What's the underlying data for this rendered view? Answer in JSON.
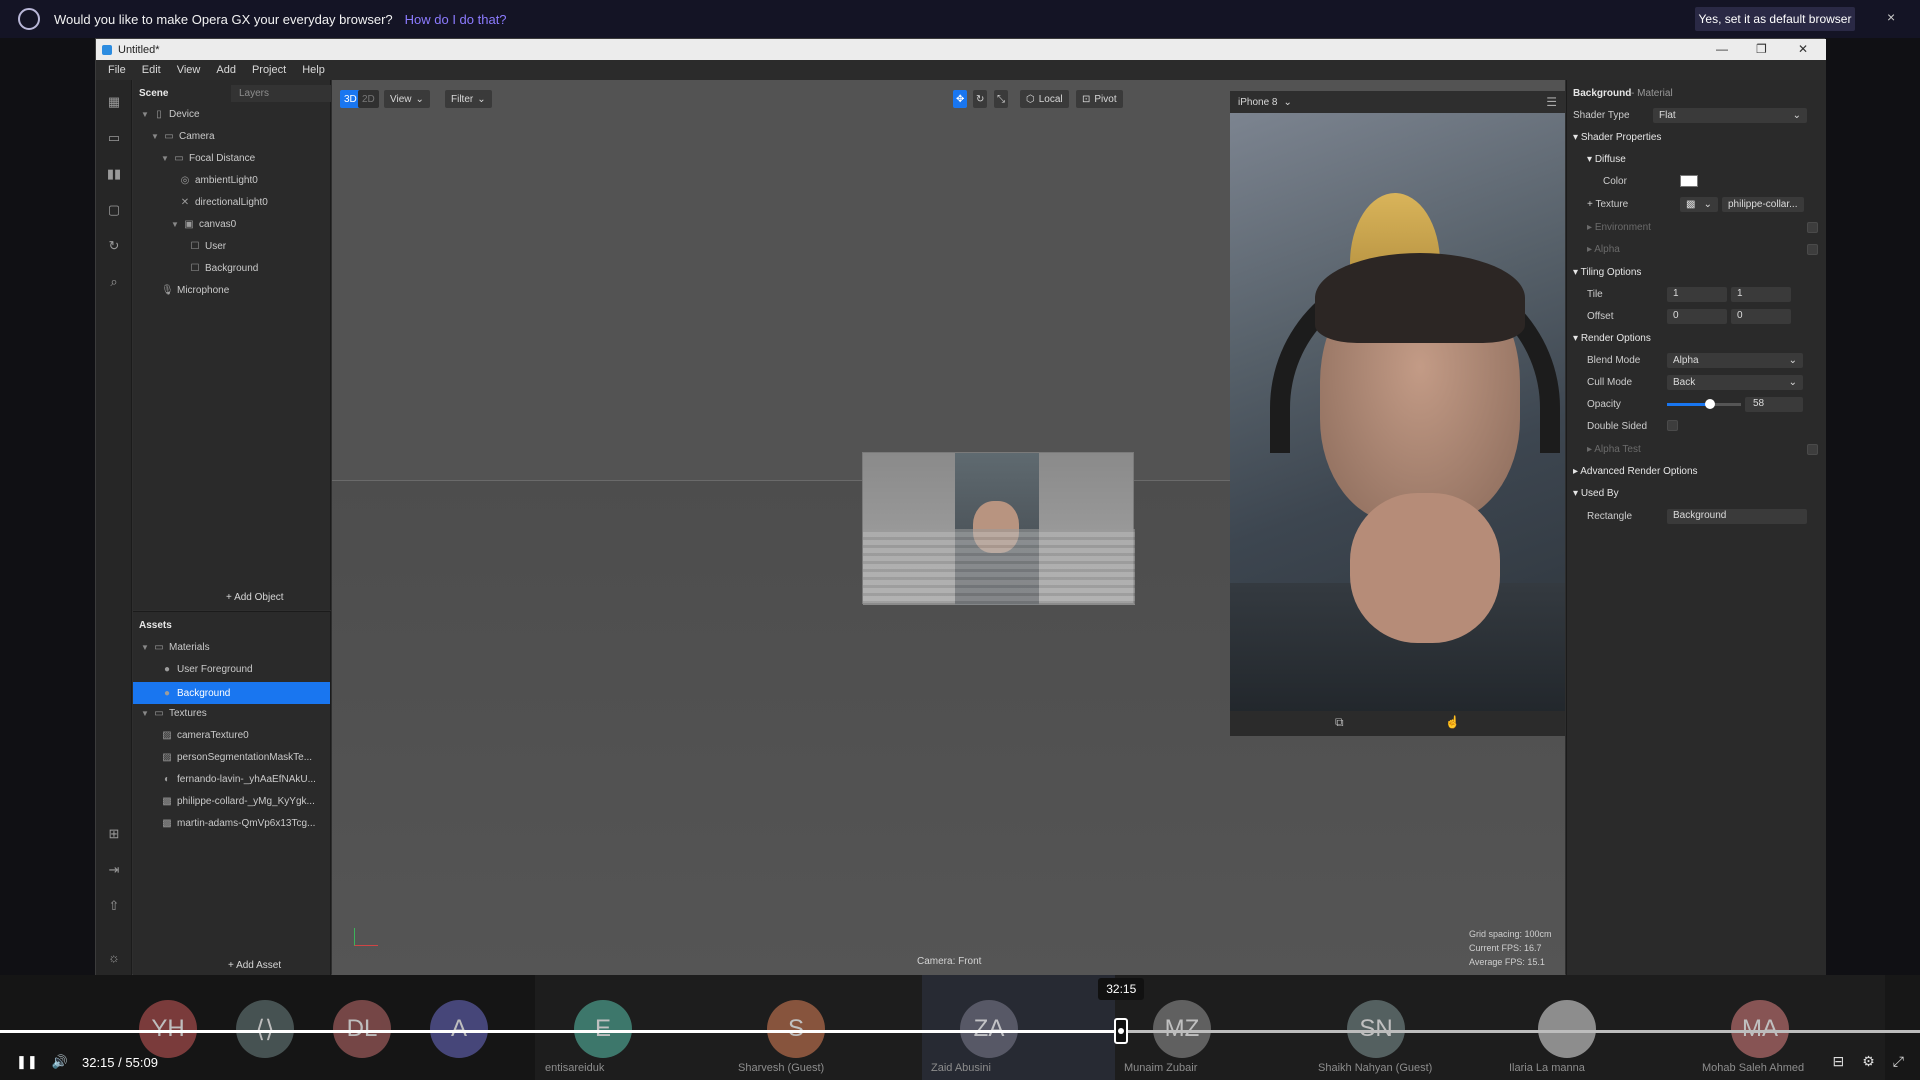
{
  "opera": {
    "question": "Would you like to make Opera GX your everyday browser?",
    "how": "How do I do that?",
    "yes": "Yes, set it as default browser",
    "close": "×"
  },
  "window": {
    "title": "Untitled*",
    "minimize": "—",
    "restore": "❐",
    "close": "✕"
  },
  "menu": [
    "File",
    "Edit",
    "View",
    "Add",
    "Project",
    "Help"
  ],
  "scene": {
    "title": "Scene",
    "tab": "Layers",
    "items": [
      {
        "label": "Device"
      },
      {
        "label": "Camera"
      },
      {
        "label": "Focal Distance"
      },
      {
        "label": "ambientLight0"
      },
      {
        "label": "directionalLight0"
      },
      {
        "label": "canvas0"
      },
      {
        "label": "User"
      },
      {
        "label": "Background"
      },
      {
        "label": "Microphone"
      }
    ],
    "add_object": "+ Add Object"
  },
  "assets": {
    "title": "Assets",
    "items": [
      {
        "label": "Materials"
      },
      {
        "label": "User Foreground"
      },
      {
        "label": "Background"
      },
      {
        "label": "Textures"
      },
      {
        "label": "cameraTexture0"
      },
      {
        "label": "personSegmentationMaskTe..."
      },
      {
        "label": "fernando-lavin-_yhAaEfNAkU..."
      },
      {
        "label": "philippe-collard-_yMg_KyYgk..."
      },
      {
        "label": "martin-adams-QmVp6x13Tcg..."
      }
    ],
    "add_asset": "+ Add Asset"
  },
  "viewport": {
    "btn3d": "3D",
    "btn2d": "2D",
    "view": "View",
    "filter": "Filter",
    "local": "Local",
    "pivot": "Pivot",
    "device": "iPhone 8",
    "camera_label": "Camera: Front",
    "grid": "Grid spacing: 100cm",
    "fps": "Current FPS: 16.7",
    "avg_fps": "Average FPS: 15.1"
  },
  "inspector": {
    "title": "Background",
    "subtitle": "- Material",
    "shader_type_label": "Shader Type",
    "shader_type": "Flat",
    "shader_props": "Shader Properties",
    "diffuse": "Diffuse",
    "color_label": "Color",
    "color": "#ffffff",
    "texture_label": "Texture",
    "texture": "philippe-collar...",
    "environment": "Environment",
    "alpha": "Alpha",
    "tiling": "Tiling Options",
    "tile_label": "Tile",
    "tile_x": "1",
    "tile_y": "1",
    "offset_label": "Offset",
    "offset_x": "0",
    "offset_y": "0",
    "render": "Render Options",
    "blend_label": "Blend Mode",
    "blend": "Alpha",
    "cull_label": "Cull Mode",
    "cull": "Back",
    "opacity_label": "Opacity",
    "opacity": "58",
    "opacity_fraction": 0.58,
    "double_label": "Double Sided",
    "alpha_test": "Alpha Test",
    "advanced": "Advanced Render Options",
    "used_by": "Used By",
    "rect_label": "Rectangle",
    "rect": "Background"
  },
  "participants": [
    {
      "initials": "YH",
      "name": "",
      "color": "#a14a4a"
    },
    {
      "initials": "⟨⟩",
      "name": "",
      "color": "#5a6a6a"
    },
    {
      "initials": "DL",
      "name": "",
      "color": "#9a5a5a"
    },
    {
      "initials": "A",
      "name": "",
      "color": "#5a5aa0"
    },
    {
      "initials": "E",
      "name": "entisareiduk",
      "color": "#4a9a8a"
    },
    {
      "initials": "S",
      "name": "Sharvesh (Guest)",
      "color": "#b06a4a"
    },
    {
      "initials": "ZA",
      "name": "Zaid Abusini",
      "color": "#6a6a7a"
    },
    {
      "initials": "MZ",
      "name": "Munaim Zubair",
      "color": "#7a7a7a"
    },
    {
      "initials": "SN",
      "name": "Shaikh Nahyan (Guest)",
      "color": "#6a7a7a"
    },
    {
      "initials": "",
      "name": "Ilaria  La manna",
      "color": "#b8b8b8"
    },
    {
      "initials": "MA",
      "name": "Mohab   Saleh Ahmed",
      "color": "#b06a6a"
    }
  ],
  "player": {
    "time": "32:15",
    "separator": "/",
    "duration": "55:09",
    "progress": 0.584,
    "tooltip": "32:15"
  }
}
